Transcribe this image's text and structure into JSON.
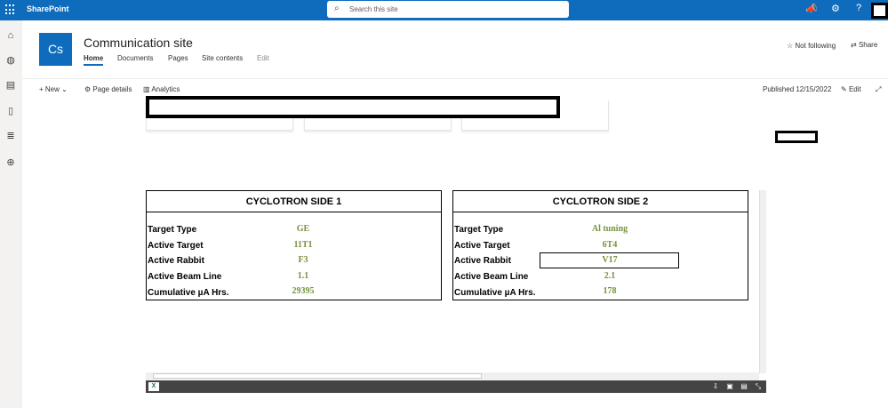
{
  "app": {
    "brand": "SharePoint"
  },
  "search": {
    "placeholder": "Search this site"
  },
  "site": {
    "logo_text": "Cs",
    "title": "Communication site",
    "nav": [
      "Home",
      "Documents",
      "Pages",
      "Site contents",
      "Edit"
    ]
  },
  "header_actions": {
    "follow": "Not following",
    "share": "Share"
  },
  "command_bar": {
    "new": "New",
    "page_details": "Page details",
    "analytics": "Analytics",
    "published": "Published 12/15/2022",
    "edit": "Edit"
  },
  "panels": [
    {
      "title": "CYCLOTRON SIDE 1",
      "rows": [
        {
          "label": "Target Type",
          "value": "GE"
        },
        {
          "label": "Active Target",
          "value": "11T1"
        },
        {
          "label": "Active Rabbit",
          "value": "F3"
        },
        {
          "label": "Active Beam Line",
          "value": "1.1"
        },
        {
          "label": "Cumulative µA Hrs.",
          "value": "29395"
        }
      ]
    },
    {
      "title": "CYCLOTRON SIDE 2",
      "rows": [
        {
          "label": "Target Type",
          "value": "Al tuning"
        },
        {
          "label": "Active Target",
          "value": "6T4"
        },
        {
          "label": "Active Rabbit",
          "value": "V17"
        },
        {
          "label": "Active Beam Line",
          "value": "2.1"
        },
        {
          "label": "Cumulative µA Hrs.",
          "value": "178"
        }
      ]
    }
  ],
  "colors": {
    "suite_bar": "#0f6cbd",
    "value_text": "#76923c"
  }
}
